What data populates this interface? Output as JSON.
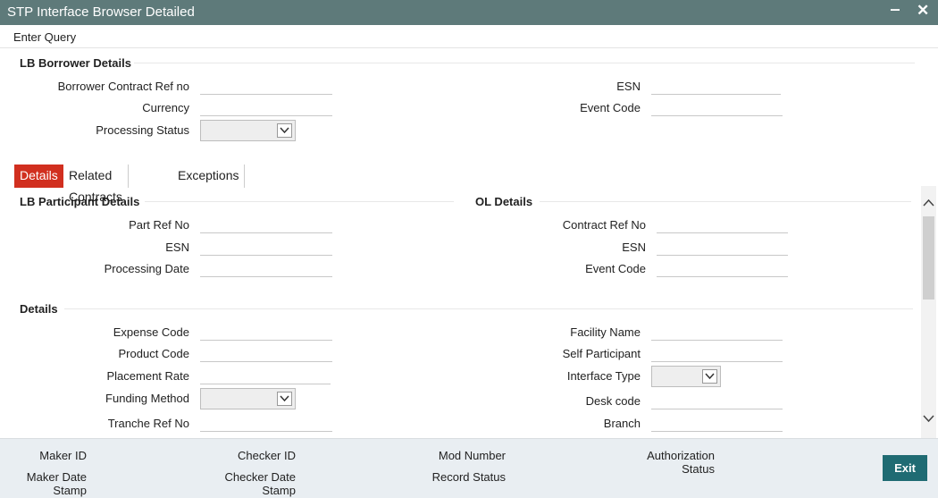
{
  "window": {
    "title": "STP Interface Browser Detailed",
    "minimize_label": "‒",
    "close_label": "✕"
  },
  "menu": {
    "enter_query": "Enter Query"
  },
  "borrower": {
    "title": "LB Borrower Details",
    "contract_ref_label": "Borrower Contract Ref no",
    "currency_label": "Currency",
    "processing_status_label": "Processing Status",
    "esn_label": "ESN",
    "event_code_label": "Event Code"
  },
  "tabs": [
    "Details",
    "Related Contracts",
    "Exceptions"
  ],
  "participant": {
    "title": "LB Participant Details",
    "part_ref_label": "Part Ref No",
    "esn_label": "ESN",
    "processing_date_label": "Processing Date"
  },
  "ol": {
    "title": "OL Details",
    "contract_ref_label": "Contract Ref No",
    "esn_label": "ESN",
    "event_code_label": "Event Code"
  },
  "details": {
    "title": "Details",
    "expense_code_label": "Expense Code",
    "product_code_label": "Product Code",
    "placement_rate_label": "Placement Rate",
    "funding_method_label": "Funding Method",
    "tranche_ref_label": "Tranche Ref No",
    "facility_name_label": "Facility Name",
    "self_participant_label": "Self Participant",
    "interface_type_label": "Interface Type",
    "desk_code_label": "Desk code",
    "branch_label": "Branch"
  },
  "footer": {
    "maker_id": "Maker ID",
    "maker_date_1": "Maker Date",
    "maker_date_2": "Stamp",
    "checker_id": "Checker ID",
    "checker_date_1": "Checker Date",
    "checker_date_2": "Stamp",
    "mod_number": "Mod Number",
    "record_status": "Record Status",
    "auth_status_1": "Authorization",
    "auth_status_2": "Status",
    "exit_label": "Exit"
  },
  "colors": {
    "titlebar": "#5e7a7a",
    "active_tab": "#d12f1f",
    "exit_button": "#1f6b73"
  }
}
